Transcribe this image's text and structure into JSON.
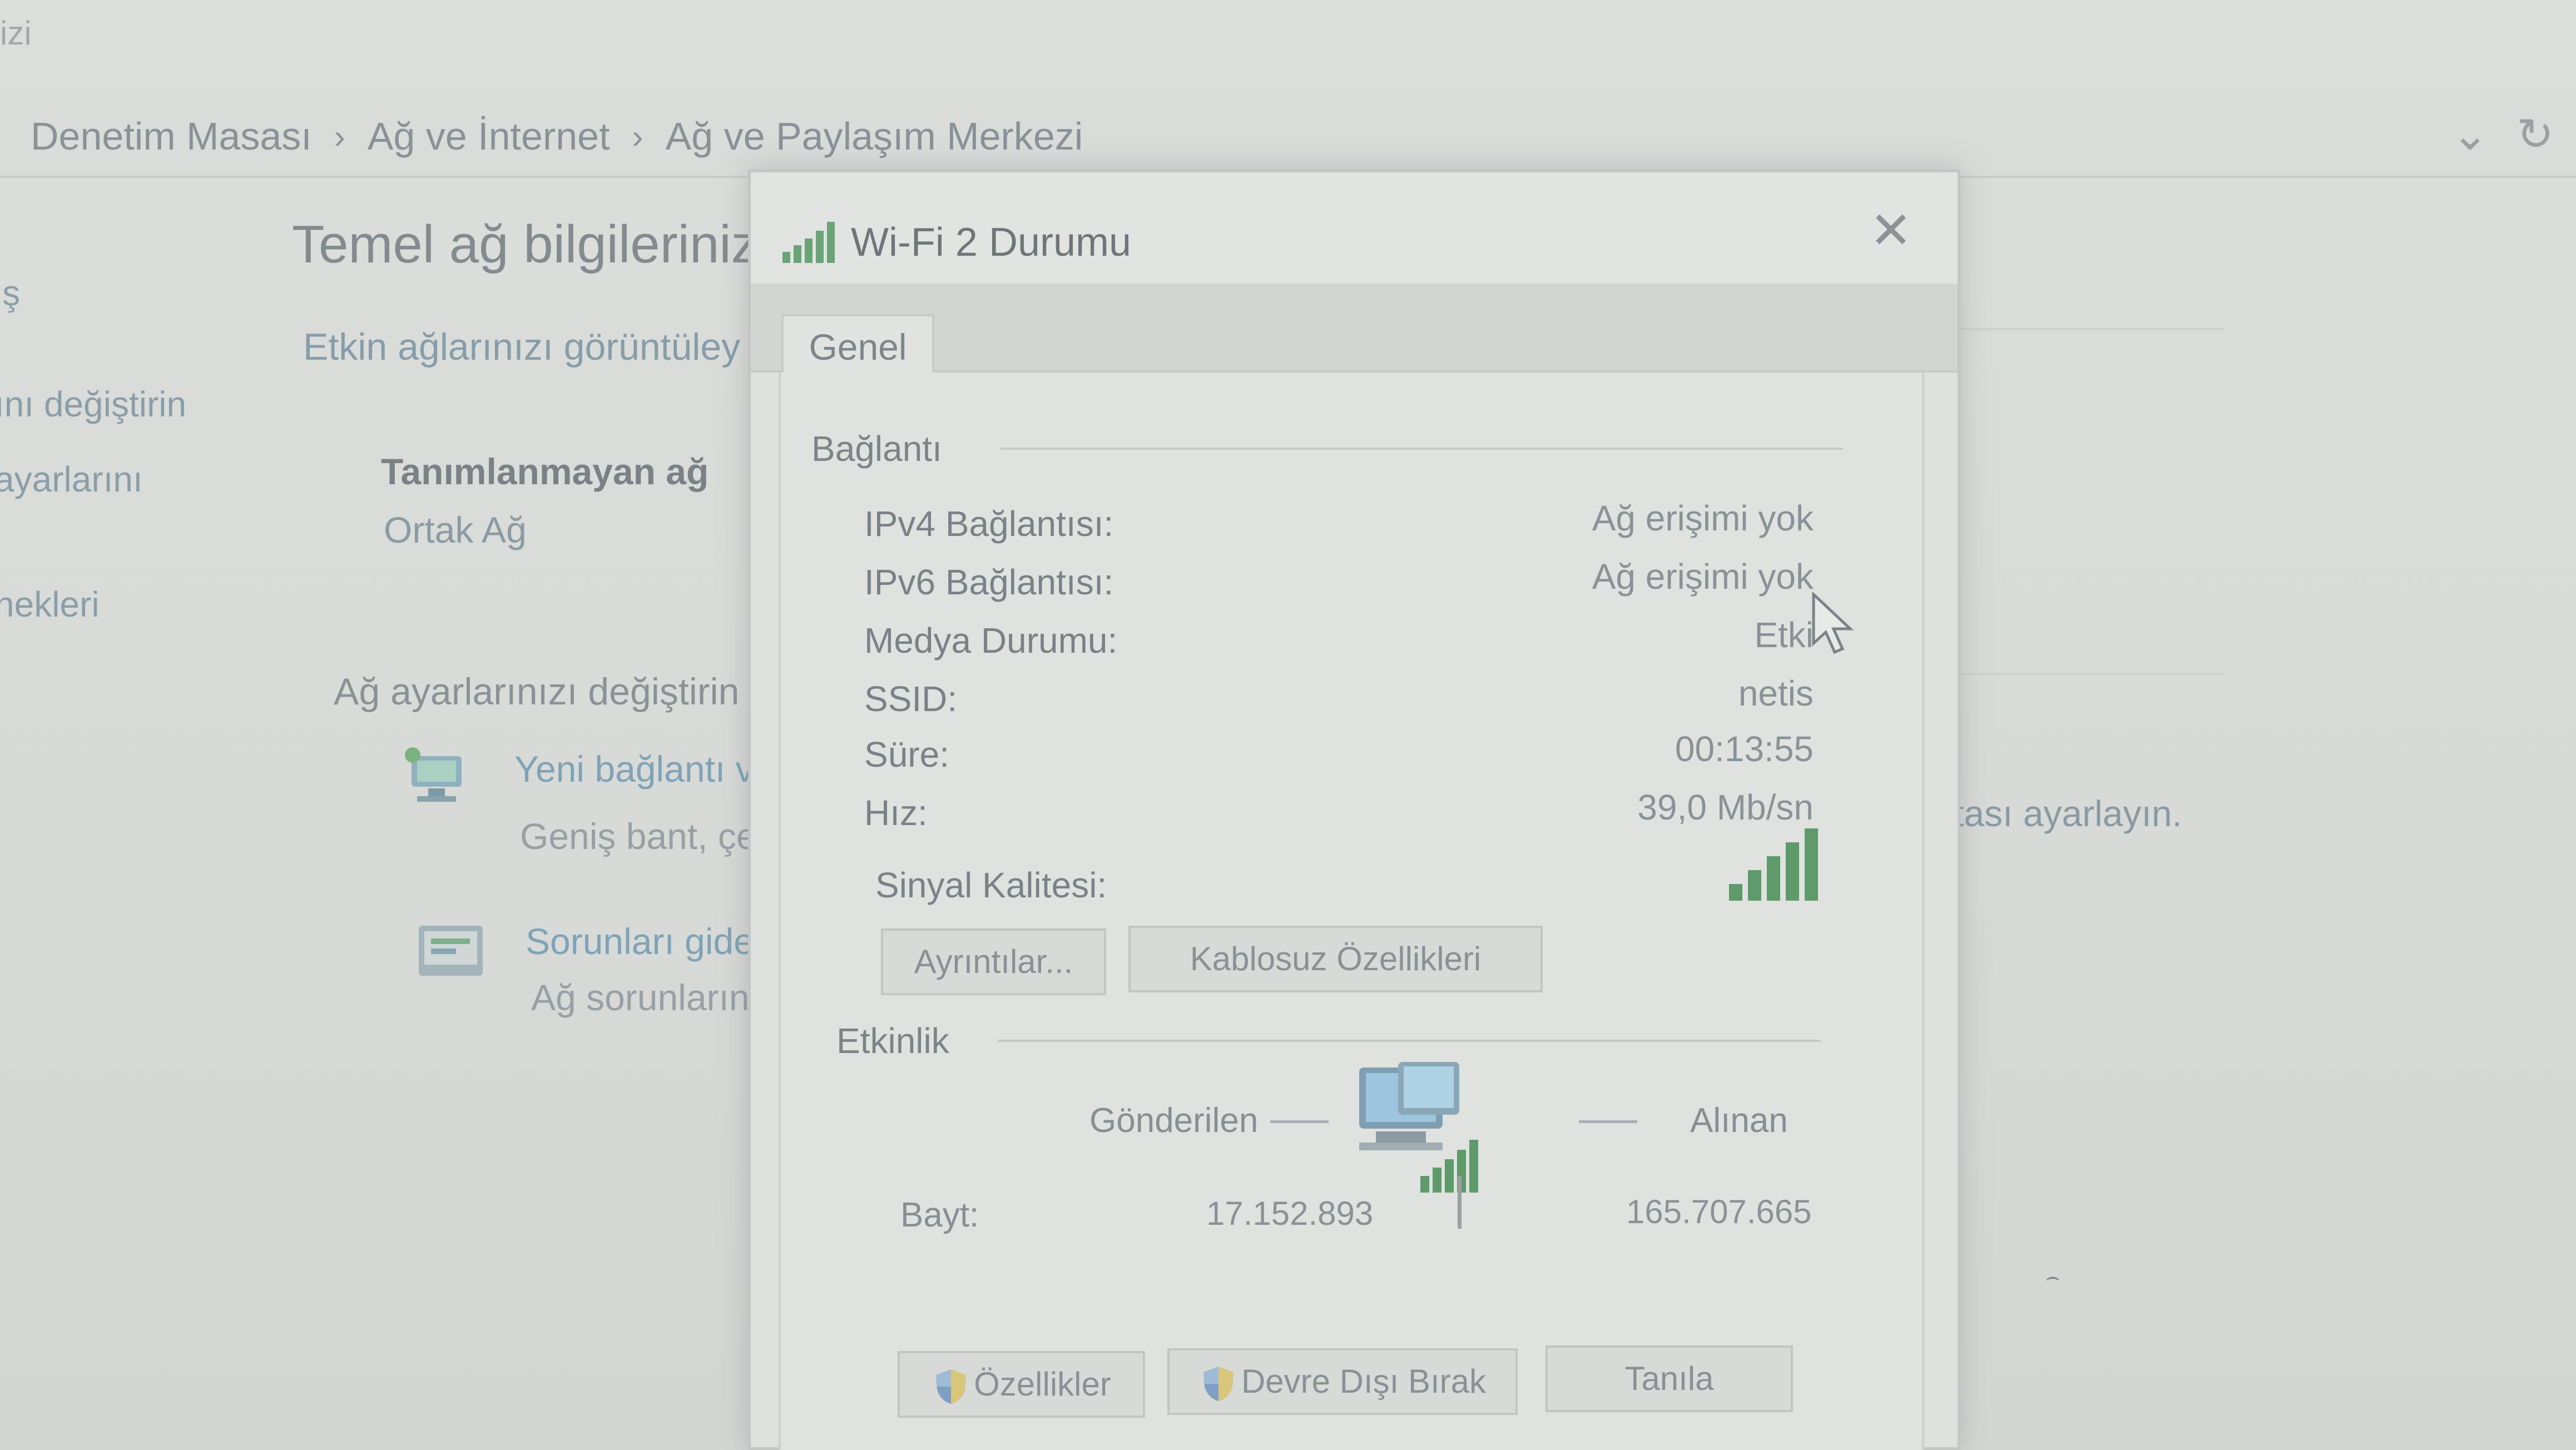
{
  "breadcrumb": {
    "items": [
      "Denetim Masası",
      "Ağ ve İnternet",
      "Ağ ve Paylaşım Merkezi"
    ],
    "separator": "›",
    "icons": [
      "chevron-down-icon",
      "refresh-icon"
    ]
  },
  "topleft_fragment": "izi",
  "sidebar": {
    "items": [
      "iş",
      "ını değiştirin",
      "ayarlarını",
      "nekleri"
    ]
  },
  "main": {
    "title": "Temel ağ bilgileriniz",
    "subtitle": "Etkin ağlarınızı görüntüley",
    "network_name": "Tanımlanmayan ağ",
    "network_type": "Ortak Ağ",
    "change_heading": "Ağ ayarlarınızı değiştirin",
    "tasks": [
      {
        "link": "Yeni bağlantı ve",
        "desc": "Geniş bant, çevi",
        "icon": "network-setup-icon"
      },
      {
        "link": "Sorunları gideri",
        "desc": "Ağ sorunlarını t",
        "icon": "troubleshoot-icon"
      }
    ],
    "right_text": "ktası ayarlayın."
  },
  "dialog": {
    "title": "Wi-Fi 2 Durumu",
    "title_icon": "wifi-signal-icon",
    "close_icon": "close-icon",
    "tab": "Genel",
    "connection": {
      "heading": "Bağlantı",
      "rows": [
        {
          "label": "IPv4 Bağlantısı:",
          "value": "Ağ erişimi yok"
        },
        {
          "label": "IPv6 Bağlantısı:",
          "value": "Ağ erişimi yok"
        },
        {
          "label": "Medya Durumu:",
          "value": "Etki"
        },
        {
          "label": "SSID:",
          "value": "netis"
        },
        {
          "label": "Süre:",
          "value": "00:13:55"
        },
        {
          "label": "Hız:",
          "value": "39,0 Mb/sn"
        }
      ],
      "signal_label": "Sinyal Kalitesi:",
      "signal_bars": 5,
      "signal_bars_total": 5,
      "details_button": "Ayrıntılar...",
      "wireless_button": "Kablosuz Özellikleri"
    },
    "activity": {
      "heading": "Etkinlik",
      "sent_label": "Gönderilen",
      "received_label": "Alınan",
      "bytes_label": "Bayt:",
      "sent_bytes": "17.152.893",
      "received_bytes": "165.707.665"
    },
    "buttons": {
      "properties": "Özellikler",
      "disable": "Devre Dışı Bırak",
      "diagnose": "Tanıla"
    }
  },
  "colors": {
    "background": "#d9dbd9",
    "dialog": "#dfe1df",
    "signal_green": "#5f9a6a",
    "link": "#7fa3b7"
  }
}
